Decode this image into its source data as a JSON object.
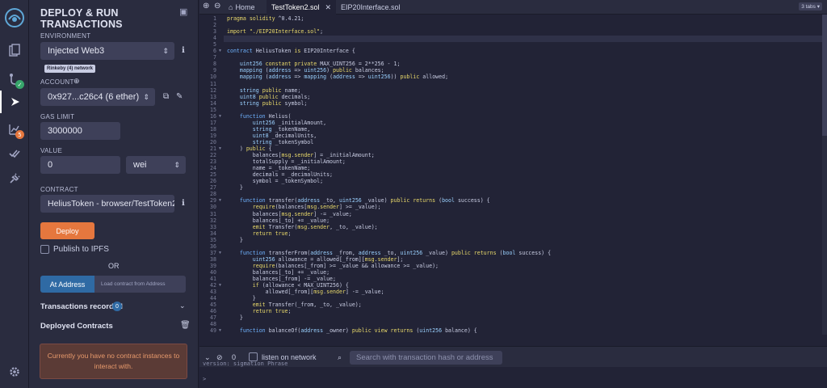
{
  "iconbar": {
    "badges": {
      "plugin_manager_check": "✓",
      "analysis_count": "5"
    }
  },
  "panel": {
    "title": "DEPLOY & RUN TRANSACTIONS",
    "environment": {
      "label": "ENVIRONMENT",
      "value": "Injected Web3",
      "network_badge": "Rinkeby (4) network"
    },
    "account": {
      "label": "ACCOUNT",
      "value": "0x927...c26c4 (6 ether)"
    },
    "gas_limit": {
      "label": "GAS LIMIT",
      "value": "3000000"
    },
    "value": {
      "label": "VALUE",
      "amount": "0",
      "unit": "wei"
    },
    "contract": {
      "label": "CONTRACT",
      "value": "HeliusToken - browser/TestToken2.sol"
    },
    "deploy_label": "Deploy",
    "publish_label": "Publish to IPFS",
    "or_label": "OR",
    "at_address_label": "At Address",
    "load_placeholder": "Load contract from Address",
    "transactions_label": "Transactions recorded",
    "transactions_count": "0",
    "deployed_label": "Deployed Contracts",
    "no_instances_msg": "Currently you have no contract instances to interact with."
  },
  "tabs": {
    "home": "Home",
    "active": "TestToken2.sol",
    "other": "EIP20Interface.sol",
    "count": "3 tabs"
  },
  "editor": {
    "lines": [
      "pragma solidity ^0.4.21;",
      "",
      "import \"./EIP20Interface.sol\";",
      "",
      "",
      "contract HeliusToken is EIP20Interface {",
      "",
      "    uint256 constant private MAX_UINT256 = 2**256 - 1;",
      "    mapping (address => uint256) public balances;",
      "    mapping (address => mapping (address => uint256)) public allowed;",
      "",
      "    string public name;",
      "    uint8 public decimals;",
      "    string public symbol;",
      "",
      "    function Helius(",
      "        uint256 _initialAmount,",
      "        string _tokenName,",
      "        uint8 _decimalUnits,",
      "        string _tokenSymbol",
      "    ) public {",
      "        balances[msg.sender] = _initialAmount;",
      "        totalSupply = _initialAmount;",
      "        name = _tokenName;",
      "        decimals = _decimalUnits;",
      "        symbol = _tokenSymbol;",
      "    }",
      "",
      "    function transfer(address _to, uint256 _value) public returns (bool success) {",
      "        require(balances[msg.sender] >= _value);",
      "        balances[msg.sender] -= _value;",
      "        balances[_to] += _value;",
      "        emit Transfer(msg.sender, _to, _value);",
      "        return true;",
      "    }",
      "",
      "    function transferFrom(address _from, address _to, uint256 _value) public returns (bool success) {",
      "        uint256 allowance = allowed[_from][msg.sender];",
      "        require(balances[_from] >= _value && allowance >= _value);",
      "        balances[_to] += _value;",
      "        balances[_from] -= _value;",
      "        if (allowance < MAX_UINT256) {",
      "            allowed[_from][msg.sender] -= _value;",
      "        }",
      "        emit Transfer(_from, _to, _value);",
      "        return true;",
      "    }",
      "",
      "    function balanceOf(address _owner) public view returns (uint256 balance) {"
    ],
    "fold_lines": [
      6,
      16,
      21,
      29,
      37,
      42,
      49
    ]
  },
  "terminal": {
    "pending_count": "0",
    "listen_label": "listen on network",
    "search_placeholder": "Search with transaction hash or address",
    "partial_line": "version: sigmation Phrase",
    "prompt": ">"
  }
}
